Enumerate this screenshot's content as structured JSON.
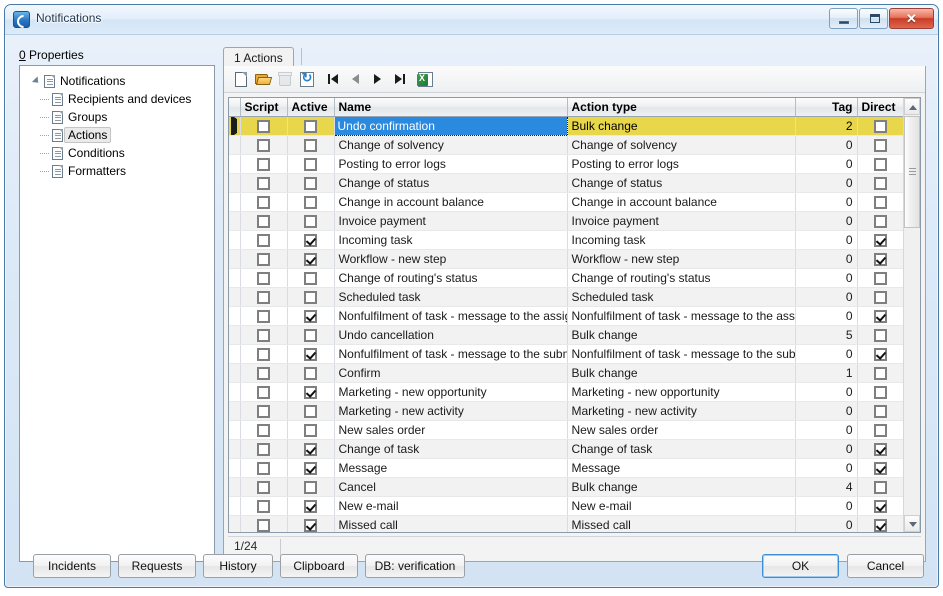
{
  "window": {
    "title": "Notifications",
    "icon": "app-icon",
    "controls": {
      "minimize": "minimize-button",
      "maximize": "maximize-button",
      "close": "close-button"
    }
  },
  "left_pane": {
    "label_accesskey": "0",
    "label": " Properties",
    "tree": {
      "root": {
        "label": "Notifications",
        "expanded": true
      },
      "children": [
        {
          "label": "Recipients and devices",
          "selected": false
        },
        {
          "label": "Groups",
          "selected": false
        },
        {
          "label": "Actions",
          "selected": true
        },
        {
          "label": "Conditions",
          "selected": false
        },
        {
          "label": "Formatters",
          "selected": false
        }
      ]
    }
  },
  "tabs": [
    {
      "accesskey": "1",
      "label": " Actions",
      "active": true
    }
  ],
  "toolbar": {
    "buttons": [
      {
        "name": "new-icon",
        "title": "New"
      },
      {
        "name": "open-icon",
        "title": "Open"
      },
      {
        "name": "delete-icon",
        "title": "Delete",
        "disabled": true
      },
      {
        "name": "refresh-icon",
        "title": "Refresh"
      },
      {
        "name": "first-record-icon",
        "title": "First"
      },
      {
        "name": "previous-record-icon",
        "title": "Previous",
        "disabled": true
      },
      {
        "name": "next-record-icon",
        "title": "Next"
      },
      {
        "name": "last-record-icon",
        "title": "Last"
      },
      {
        "name": "export-excel-icon",
        "title": "Export to Excel"
      }
    ]
  },
  "grid": {
    "columns": [
      {
        "key": "indicator",
        "label": ""
      },
      {
        "key": "script",
        "label": "Script"
      },
      {
        "key": "active",
        "label": "Active"
      },
      {
        "key": "name",
        "label": "Name"
      },
      {
        "key": "action_type",
        "label": "Action type"
      },
      {
        "key": "tag",
        "label": "Tag"
      },
      {
        "key": "direct",
        "label": "Direct"
      }
    ],
    "rows": [
      {
        "selected": true,
        "script": false,
        "active": false,
        "name": "Undo confirmation",
        "action_type": "Bulk change",
        "tag": "2",
        "direct": false
      },
      {
        "selected": false,
        "script": false,
        "active": false,
        "name": "Change of solvency",
        "action_type": "Change of solvency",
        "tag": "0",
        "direct": false
      },
      {
        "selected": false,
        "script": false,
        "active": false,
        "name": "Posting to error logs",
        "action_type": "Posting to error logs",
        "tag": "0",
        "direct": false
      },
      {
        "selected": false,
        "script": false,
        "active": false,
        "name": "Change of status",
        "action_type": "Change of status",
        "tag": "0",
        "direct": false
      },
      {
        "selected": false,
        "script": false,
        "active": false,
        "name": "Change in account balance",
        "action_type": "Change in account balance",
        "tag": "0",
        "direct": false
      },
      {
        "selected": false,
        "script": false,
        "active": false,
        "name": "Invoice payment",
        "action_type": "Invoice payment",
        "tag": "0",
        "direct": false
      },
      {
        "selected": false,
        "script": false,
        "active": true,
        "name": "Incoming task",
        "action_type": "Incoming task",
        "tag": "0",
        "direct": true
      },
      {
        "selected": false,
        "script": false,
        "active": true,
        "name": "Workflow - new step",
        "action_type": "Workflow - new step",
        "tag": "0",
        "direct": true
      },
      {
        "selected": false,
        "script": false,
        "active": false,
        "name": "Change of routing's status",
        "action_type": "Change of routing's status",
        "tag": "0",
        "direct": false
      },
      {
        "selected": false,
        "script": false,
        "active": false,
        "name": "Scheduled task",
        "action_type": "Scheduled task",
        "tag": "0",
        "direct": false
      },
      {
        "selected": false,
        "script": false,
        "active": true,
        "name": "Nonfulfilment of task - message to the assignee",
        "action_type": "Nonfulfilment of task - message to the assignee",
        "tag": "0",
        "direct": true
      },
      {
        "selected": false,
        "script": false,
        "active": false,
        "name": "Undo cancellation",
        "action_type": "Bulk change",
        "tag": "5",
        "direct": false
      },
      {
        "selected": false,
        "script": false,
        "active": true,
        "name": "Nonfulfilment of task - message to the submitte",
        "action_type": "Nonfulfilment of task - message to the submitte",
        "tag": "0",
        "direct": true
      },
      {
        "selected": false,
        "script": false,
        "active": false,
        "name": "Confirm",
        "action_type": "Bulk change",
        "tag": "1",
        "direct": false
      },
      {
        "selected": false,
        "script": false,
        "active": true,
        "name": "Marketing - new opportunity",
        "action_type": "Marketing - new opportunity",
        "tag": "0",
        "direct": false
      },
      {
        "selected": false,
        "script": false,
        "active": false,
        "name": "Marketing - new activity",
        "action_type": "Marketing - new activity",
        "tag": "0",
        "direct": false
      },
      {
        "selected": false,
        "script": false,
        "active": false,
        "name": "New sales order",
        "action_type": "New sales order",
        "tag": "0",
        "direct": false
      },
      {
        "selected": false,
        "script": false,
        "active": true,
        "name": "Change of task",
        "action_type": "Change of task",
        "tag": "0",
        "direct": true
      },
      {
        "selected": false,
        "script": false,
        "active": true,
        "name": "Message",
        "action_type": "Message",
        "tag": "0",
        "direct": true
      },
      {
        "selected": false,
        "script": false,
        "active": false,
        "name": "Cancel",
        "action_type": "Bulk change",
        "tag": "4",
        "direct": false
      },
      {
        "selected": false,
        "script": false,
        "active": true,
        "name": "New e-mail",
        "action_type": "New e-mail",
        "tag": "0",
        "direct": true
      },
      {
        "selected": false,
        "script": false,
        "active": true,
        "name": "Missed call",
        "action_type": "Missed call",
        "tag": "0",
        "direct": true
      }
    ]
  },
  "status": {
    "record_position": "1/24"
  },
  "bottom_buttons": [
    {
      "label": "Incidents"
    },
    {
      "label": "Requests"
    },
    {
      "label": "History"
    },
    {
      "label": "Clipboard"
    },
    {
      "label": "DB: verification"
    }
  ],
  "dialog_buttons": {
    "ok": "OK",
    "cancel": "Cancel"
  },
  "colors": {
    "selected_row": "#e8d64b",
    "selected_cell": "#2a8ae0",
    "title_accent": "#4a7ba7"
  }
}
